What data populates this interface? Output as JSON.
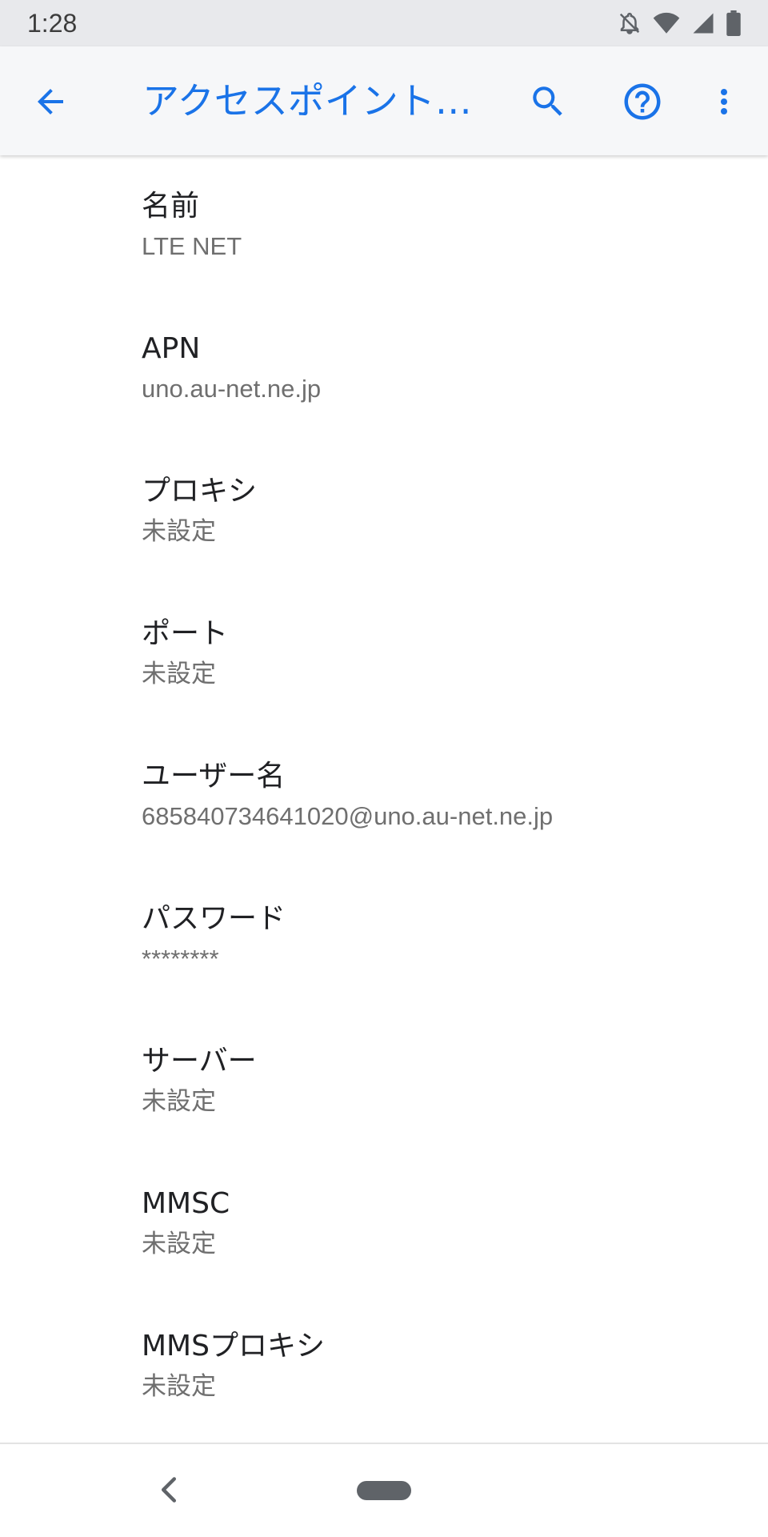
{
  "status_bar": {
    "time": "1:28",
    "icons": [
      "bell-off-icon",
      "wifi-icon",
      "cellular-signal-icon",
      "battery-icon"
    ]
  },
  "app_bar": {
    "title": "アクセスポイント…",
    "icons": [
      "back-arrow-icon",
      "search-icon",
      "help-icon",
      "more-vert-icon"
    ],
    "accent_color": "#1a73e8"
  },
  "settings": [
    {
      "title": "名前",
      "value": "LTE NET"
    },
    {
      "title": "APN",
      "value": "uno.au-net.ne.jp"
    },
    {
      "title": "プロキシ",
      "value": "未設定"
    },
    {
      "title": "ポート",
      "value": "未設定"
    },
    {
      "title": "ユーザー名",
      "value": "685840734641020@uno.au-net.ne.jp"
    },
    {
      "title": "パスワード",
      "value": "********"
    },
    {
      "title": "サーバー",
      "value": "未設定"
    },
    {
      "title": "MMSC",
      "value": "未設定"
    },
    {
      "title": "MMSプロキシ",
      "value": "未設定"
    }
  ],
  "nav_bar": {
    "icons": [
      "nav-back-icon",
      "home-pill-icon"
    ]
  }
}
